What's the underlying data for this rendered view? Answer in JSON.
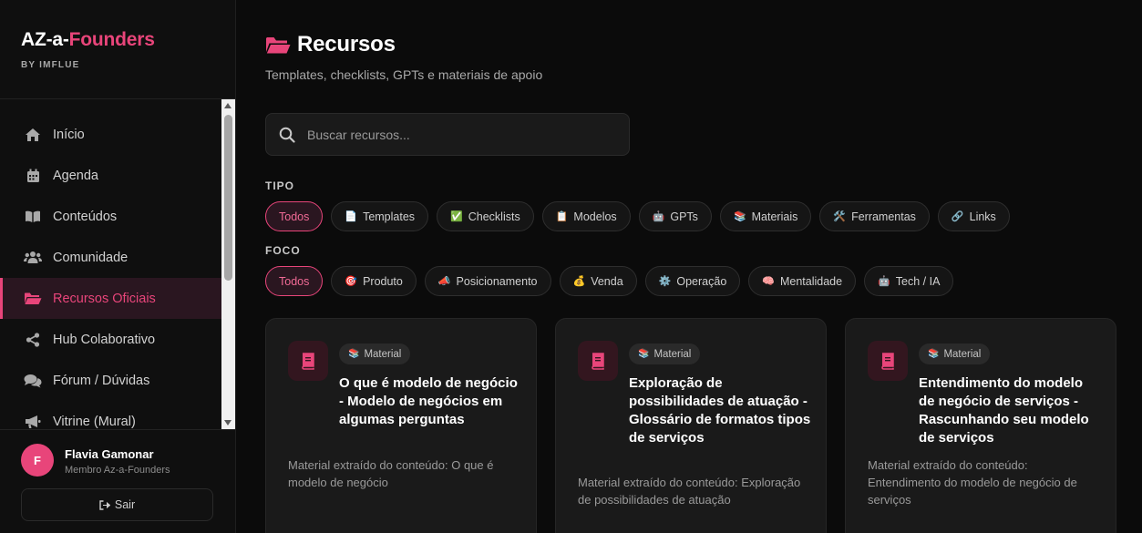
{
  "brand": {
    "title_main": "AZ-a-",
    "title_accent": "Founders",
    "subtitle": "BY IMFLUE"
  },
  "sidebar": {
    "items": [
      {
        "label": "Início",
        "icon": "home-icon"
      },
      {
        "label": "Agenda",
        "icon": "calendar-icon"
      },
      {
        "label": "Conteúdos",
        "icon": "book-icon"
      },
      {
        "label": "Comunidade",
        "icon": "users-icon"
      },
      {
        "label": "Recursos Oficiais",
        "icon": "folder-open-icon",
        "active": true
      },
      {
        "label": "Hub Colaborativo",
        "icon": "share-icon"
      },
      {
        "label": "Fórum / Dúvidas",
        "icon": "comments-icon"
      },
      {
        "label": "Vitrine (Mural)",
        "icon": "megaphone-icon"
      }
    ]
  },
  "user": {
    "initial": "F",
    "name": "Flavia Gamonar",
    "role": "Membro Az-a-Founders",
    "logout_label": "Sair"
  },
  "page": {
    "title": "Recursos",
    "subtitle": "Templates, checklists, GPTs e materiais de apoio"
  },
  "search": {
    "placeholder": "Buscar recursos...",
    "value": ""
  },
  "filters": {
    "tipo_label": "TIPO",
    "tipo": [
      {
        "emoji": "",
        "label": "Todos",
        "active": true
      },
      {
        "emoji": "📄",
        "label": "Templates"
      },
      {
        "emoji": "✅",
        "label": "Checklists"
      },
      {
        "emoji": "📋",
        "label": "Modelos"
      },
      {
        "emoji": "🤖",
        "label": "GPTs"
      },
      {
        "emoji": "📚",
        "label": "Materiais"
      },
      {
        "emoji": "🛠️",
        "label": "Ferramentas"
      },
      {
        "emoji": "🔗",
        "label": "Links"
      }
    ],
    "foco_label": "FOCO",
    "foco": [
      {
        "emoji": "",
        "label": "Todos",
        "active": true
      },
      {
        "emoji": "🎯",
        "label": "Produto"
      },
      {
        "emoji": "📣",
        "label": "Posicionamento"
      },
      {
        "emoji": "💰",
        "label": "Venda"
      },
      {
        "emoji": "⚙️",
        "label": "Operação"
      },
      {
        "emoji": "🧠",
        "label": "Mentalidade"
      },
      {
        "emoji": "🤖",
        "label": "Tech / IA"
      }
    ]
  },
  "cards": [
    {
      "badge_emoji": "📚",
      "badge": "Material",
      "title": "O que é modelo de negócio - Modelo de negócios em algumas perguntas",
      "description": "Material extraído do conteúdo: O que é modelo de negócio"
    },
    {
      "badge_emoji": "📚",
      "badge": "Material",
      "title": "Exploração de possibilidades de atuação - Glossário de formatos tipos de serviços",
      "description": "Material extraído do conteúdo: Exploração de possibilidades de atuação"
    },
    {
      "badge_emoji": "📚",
      "badge": "Material",
      "title": "Entendimento do modelo de negócio de serviços - Rascunhando seu modelo de serviços",
      "description": "Material extraído do conteúdo: Entendimento do modelo de negócio de serviços"
    }
  ],
  "colors": {
    "accent": "#e8457a",
    "background": "#0b0b0b",
    "card": "#1a1a1a"
  }
}
